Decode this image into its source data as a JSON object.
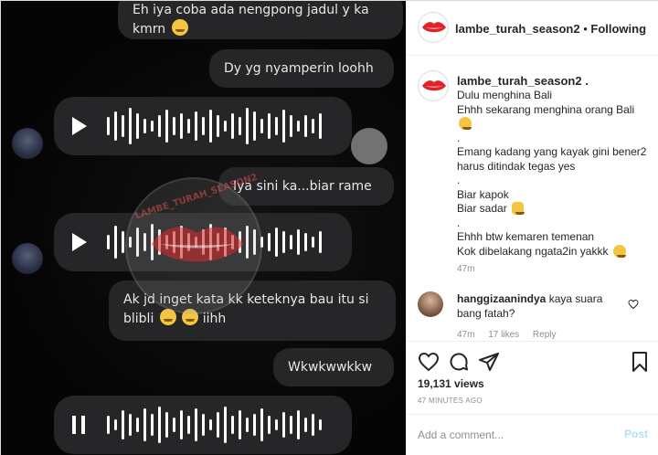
{
  "media": {
    "msg_top": "Eh iya coba ada nengpong jadul y ka kmrn",
    "msg_dy": "Dy yg nyamperin loohh",
    "msg_iya": "Iya sini ka...biar rame",
    "msg_ak": "Ak jd inget kata kk keteknya bau itu si blibli",
    "msg_ak_tail": "iihh",
    "msg_wk": "Wkwkwwkkw",
    "watermark_text": "LAMBE_TURAH_SEASON2"
  },
  "header": {
    "username": "lambe_turah_season2",
    "separator": "•",
    "follow_label": "Following"
  },
  "caption": {
    "username": "lambe_turah_season2",
    "username_suffix": ".",
    "lines": [
      "Dulu menghina Bali",
      "Ehhh sekarang menghina orang Bali",
      "",
      ".",
      "Emang kadang yang kayak gini bener2",
      "harus ditindak tegas yes",
      ".",
      "Biar kapok",
      "Biar sadar",
      ".",
      "Ehhh btw kemaren temenan",
      "Kok dibelakang ngata2in yakkk"
    ],
    "time": "47m"
  },
  "comment": {
    "username": "hanggizaanindya",
    "text": "kaya suara bang fatah?",
    "time": "47m",
    "likes": "17 likes",
    "reply": "Reply"
  },
  "actions": {
    "likes": "19,131 views",
    "ago": "47 MINUTES AGO"
  },
  "add_comment": {
    "placeholder": "Add a comment...",
    "post_label": "Post"
  },
  "colors": {
    "bubble": "#262629",
    "media_bg": "#050505",
    "post_disabled": "#b2dffc",
    "brand_red": "#e0232b"
  }
}
